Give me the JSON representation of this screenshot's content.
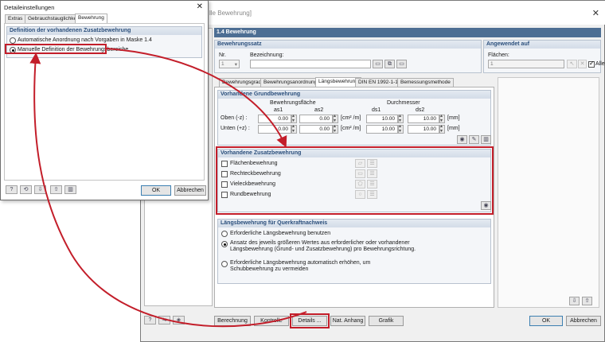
{
  "main": {
    "title": "lle Bewehrung]",
    "section": "1.4 Bewehrung",
    "bewehrungssatz": {
      "header": "Bewehrungssatz",
      "nr_label": "Nr.",
      "nr_value": "1",
      "bez_label": "Bezeichnung:"
    },
    "angewendet": {
      "header": "Angewendet auf",
      "flaechen_label": "Flächen:",
      "flaechen_value": "1",
      "alle_label": "Alle"
    },
    "tabs": [
      "Bewehrungsgrade",
      "Bewehrungsanordnung",
      "Längsbewehrung",
      "DIN EN 1992-1-1",
      "Bemessungsmethode"
    ],
    "grund": {
      "header": "Vorhandene Grundbewehrung",
      "col_flaeche": "Bewehrungsfläche",
      "col_durchmesser": "Durchmesser",
      "as1": "as1",
      "as2": "as2",
      "ds1": "ds1",
      "ds2": "ds2",
      "row1_label": "Oben (-z) :",
      "row2_label": "Unten (+z) :",
      "r1_as1": "0.00",
      "r1_as2": "0.00",
      "r1_unit": "[cm² /m]",
      "r1_ds1": "10.00",
      "r1_ds2": "10.00",
      "r1_unit2": "[mm]",
      "r2_as1": "0.00",
      "r2_as2": "0.00",
      "r2_unit": "[cm² /m]",
      "r2_ds1": "10.00",
      "r2_ds2": "10.00",
      "r2_unit2": "[mm]"
    },
    "zusatz": {
      "header": "Vorhandene Zusatzbewehrung",
      "items": [
        "Flächenbewehrung",
        "Rechteckbewehrung",
        "Vieleckbewehrung",
        "Rundbewehrung"
      ]
    },
    "quer": {
      "header": "Längsbewehrung für Querkraftnachweis",
      "opt1": "Erforderliche Längsbewehrung benutzen",
      "opt2_l1": "Ansatz des jeweils größeren Wertes aus erforderlicher oder vorhandener",
      "opt2_l2": "Längsbewehrung (Grund- und Zusatzbewehrung) pro Bewehrungsrichtung.",
      "opt3_l1": "Erforderliche Längsbewehrung automatisch erhöhen, um",
      "opt3_l2": "Schubbewehrung zu vermeiden"
    },
    "buttons": {
      "berechnung": "Berechnung",
      "kontrolle": "Kontrolle",
      "details": "Details ...",
      "nat_anhang": "Nat. Anhang",
      "grafik": "Grafik",
      "ok": "OK",
      "abbrechen": "Abbrechen"
    }
  },
  "detail": {
    "title": "Detaileinstellungen",
    "tabs": [
      "Extras",
      "Gebrauchstauglichkeit",
      "Bewehrung"
    ],
    "group_header": "Definition der vorhandenen Zusatzbewehrung",
    "opt_auto": "Automatische Anordnung nach Vorgaben in Maske 1.4",
    "opt_manual": "Manuelle Definition der Bewehrungsbereiche",
    "ok": "OK",
    "cancel": "Abbrechen"
  },
  "colors": {
    "highlight": "#c31e2a",
    "section_bar": "#4d6e93",
    "group_header_text": "#2b4f7c"
  }
}
